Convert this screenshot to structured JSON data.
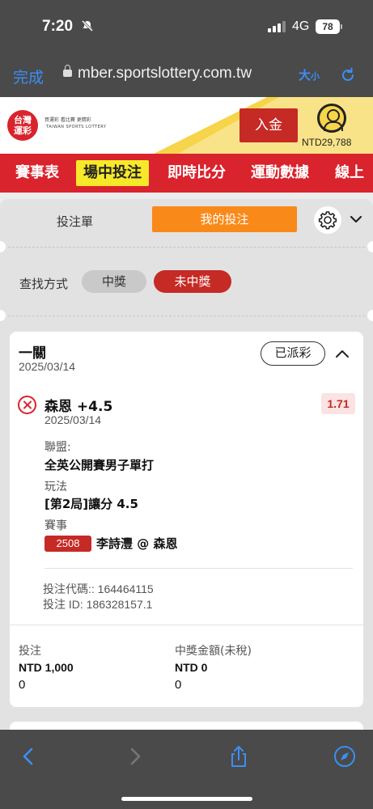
{
  "status_bar": {
    "time": "7:20",
    "network": "4G",
    "battery": "78"
  },
  "browser": {
    "done_label": "完成",
    "url": "mber.sportslottery.com.tw",
    "text_size_label": "大",
    "text_size_small": "小"
  },
  "site": {
    "logo_line1": "台灣",
    "logo_line2": "運彩",
    "logo_text1": "買運彩  看比賽  更精彩",
    "logo_text2": "TAIWAN SPORTS LOTTERY",
    "deposit_label": "入金",
    "balance": "NTD29,788"
  },
  "main_nav": {
    "items": [
      {
        "label": "賽事表"
      },
      {
        "label": "場中投注"
      },
      {
        "label": "即時比分"
      },
      {
        "label": "運動數據"
      },
      {
        "label": "線上"
      }
    ]
  },
  "tabs": {
    "slip_label": "投注單",
    "my_bets_label": "我的投注"
  },
  "filter": {
    "label": "查找方式",
    "options": [
      "中獎",
      "未中獎"
    ],
    "selected": "未中獎"
  },
  "bet_card": {
    "type": "一關",
    "date": "2025/03/14",
    "status": "已派彩",
    "selection": {
      "name": "森恩 +4.5",
      "date": "2025/03/14",
      "odds": "1.71",
      "league_label": "聯盟:",
      "league": "全英公開賽男子單打",
      "market_label": "玩法",
      "market": "[第2局]讓分 4.5",
      "event_label": "賽事",
      "event_code": "2508",
      "event_name": "李詩灃 @ 森恩"
    },
    "bet_code": "投注代碼:: 164464115",
    "bet_id": "投注 ID: 186328157.1",
    "footer": {
      "stake_label": "投注",
      "stake_amount": "NTD 1,000",
      "stake_value": "0",
      "payout_label": "中獎金額(未稅)",
      "payout_amount": "NTD 0",
      "payout_value": "0"
    }
  },
  "colors": {
    "brand_red": "#d9232d",
    "accent_orange": "#f98a1a",
    "nav_highlight": "#f6e92a",
    "ios_blue": "#3a8ff5"
  }
}
